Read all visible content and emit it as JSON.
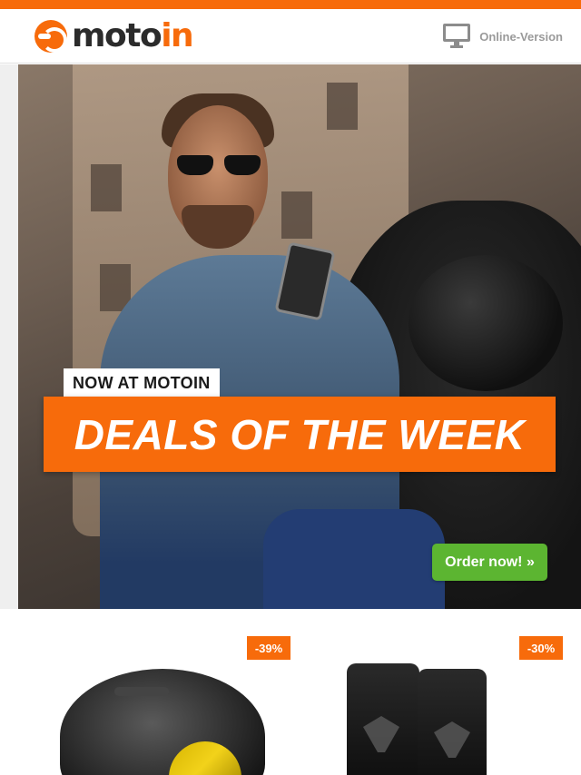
{
  "header": {
    "logo_text_a": "moto",
    "logo_text_b": "in",
    "online_version_label": "Online-Version",
    "online_version_icon": "monitor-icon"
  },
  "colors": {
    "brand_orange": "#f76b0b",
    "order_green": "#5cb531"
  },
  "hero": {
    "tagline": "NOW AT MOTOIN",
    "headline": "DEALS OF THE WEEK",
    "cta_label": "Order now! »"
  },
  "products": [
    {
      "discount": "-39%",
      "image": "motorcycle-helmet"
    },
    {
      "discount": "-30%",
      "image": "motorcycle-boots"
    }
  ]
}
